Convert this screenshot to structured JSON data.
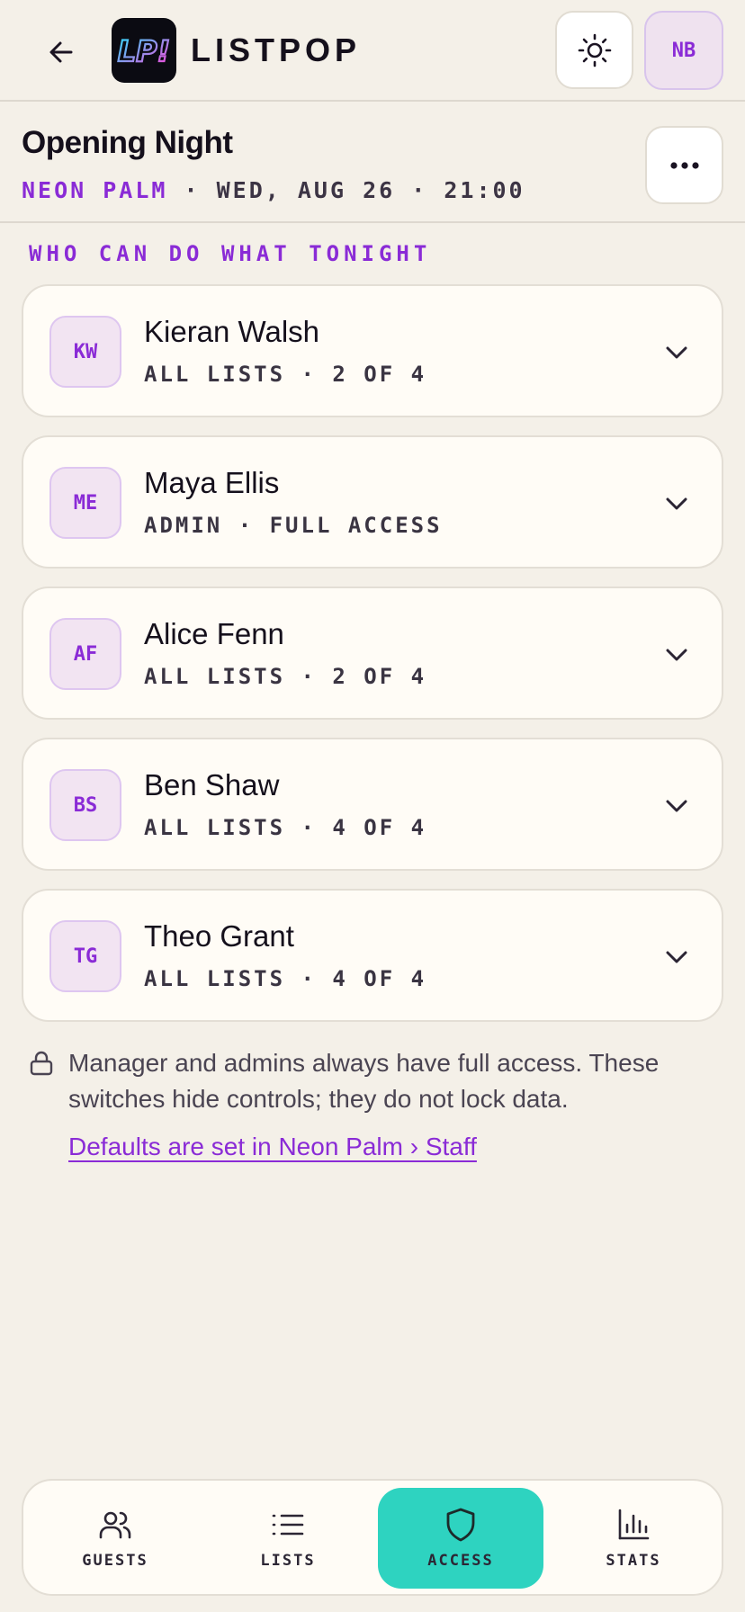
{
  "header": {
    "brand": "LISTPOP",
    "logo_text": "LP!",
    "avatar_initials": "NB",
    "back_icon": "arrow-left-icon",
    "theme_icon": "sun-icon"
  },
  "event": {
    "title": "Opening Night",
    "venue": "NEON PALM",
    "details": " · WED, AUG 26 · 21:00",
    "more_icon": "ellipsis-icon"
  },
  "section_heading": "WHO CAN DO WHAT TONIGHT",
  "staff": [
    {
      "initials": "KW",
      "name": "Kieran Walsh",
      "role": "ALL LISTS · 2 OF 4"
    },
    {
      "initials": "ME",
      "name": "Maya Ellis",
      "role": "ADMIN · FULL ACCESS"
    },
    {
      "initials": "AF",
      "name": "Alice Fenn",
      "role": "ALL LISTS · 2 OF 4"
    },
    {
      "initials": "BS",
      "name": "Ben Shaw",
      "role": "ALL LISTS · 4 OF 4"
    },
    {
      "initials": "TG",
      "name": "Theo Grant",
      "role": "ALL LISTS · 4 OF 4"
    }
  ],
  "note": {
    "text": "Manager and admins always have full access. These switches hide controls; they do not lock data.",
    "link": "Defaults are set in Neon Palm › Staff"
  },
  "nav": [
    {
      "label": "GUESTS",
      "icon": "users-icon",
      "active": false
    },
    {
      "label": "LISTS",
      "icon": "list-icon",
      "active": false
    },
    {
      "label": "ACCESS",
      "icon": "shield-icon",
      "active": true
    },
    {
      "label": "STATS",
      "icon": "bar-chart-icon",
      "active": false
    }
  ],
  "colors": {
    "background": "#f4f0e8",
    "accent_purple": "#8a2bd6",
    "active_teal": "#2ed3c0",
    "card": "#fffcf6"
  }
}
